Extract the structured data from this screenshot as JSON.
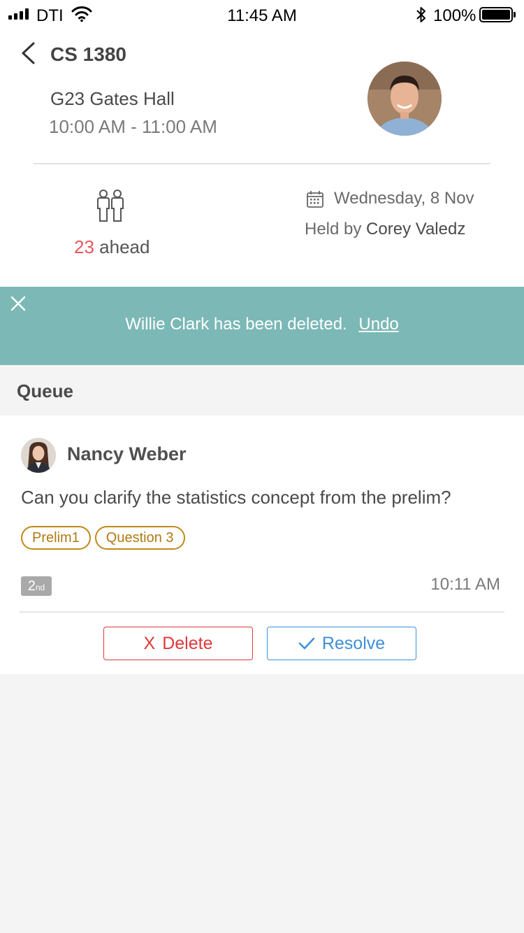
{
  "status_bar": {
    "carrier": "DTI",
    "time": "11:45 AM",
    "battery": "100%"
  },
  "header": {
    "course_title": "CS 1380",
    "location": "G23 Gates Hall",
    "time_range": "10:00 AM - 11:00 AM",
    "ahead_count": "23",
    "ahead_label": "ahead",
    "date": "Wednesday, 8 Nov",
    "held_by_label": "Held by",
    "held_by_name": "Corey Valedz"
  },
  "snackbar": {
    "message": "Willie Clark has been deleted.",
    "undo_label": "Undo"
  },
  "queue": {
    "title": "Queue",
    "item": {
      "name": "Nancy Weber",
      "question": "Can you clarify the statistics concept from the prelim?",
      "tags": [
        "Prelim1",
        "Question 3"
      ],
      "position": "2",
      "position_suffix": "nd",
      "time": "10:11 AM",
      "delete_label": "Delete",
      "delete_icon_glyph": "X",
      "resolve_label": "Resolve"
    }
  },
  "colors": {
    "snackbar_bg": "#7bb8b6",
    "ahead_number": "#e8595e",
    "tag": "#c08a18",
    "delete": "#e0383c",
    "resolve": "#3f8fd8"
  },
  "icons": [
    "back-arrow-icon",
    "people-icon",
    "calendar-icon",
    "close-icon",
    "checkmark-icon",
    "wifi-icon",
    "bluetooth-icon",
    "battery-icon",
    "signal-icon"
  ]
}
